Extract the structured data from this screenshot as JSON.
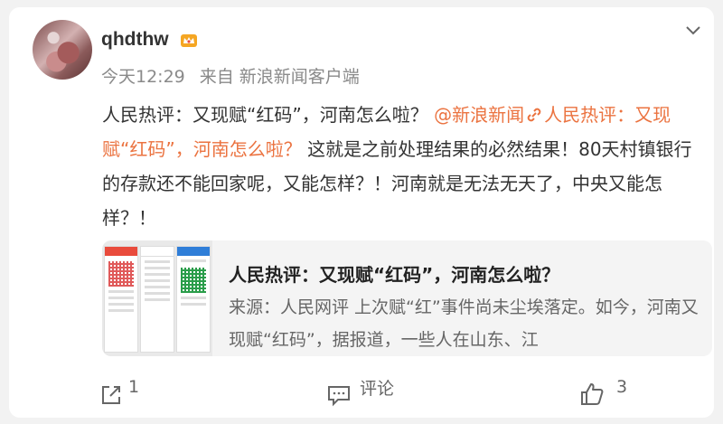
{
  "post": {
    "username": "qhdthw",
    "time": "今天12:29",
    "source": "来自 新浪新闻客户端",
    "text_intro": "人民热评：又现赋“红码”，河南怎么啦？ ",
    "mention": "@新浪新闻",
    "link_part1": "人民热评：",
    "link_part2": "又现赋“红码”，河南怎么啦？",
    "text_body": " 这就是之前处理结果的必然结果！80天村镇银行的存款还不能回家呢，又能怎样？！河南就是无法无天了，中央又能怎样？！"
  },
  "share_card": {
    "title": "人民热评：又现赋“红码”，河南怎么啦？",
    "description": "来源：人民网评 上次赋“红”事件尚未尘埃落定。如今，河南又现赋“红码”，据报道，一些人在山东、江"
  },
  "actions": {
    "repost_count": "1",
    "comment_label": "评论",
    "like_count": "3"
  },
  "icons": [
    "vip-crown-icon",
    "chevron-down-icon",
    "link-icon",
    "share-icon",
    "comment-icon",
    "like-icon"
  ],
  "colors": {
    "accent": "#eb7340",
    "vip": "#f5a623"
  }
}
